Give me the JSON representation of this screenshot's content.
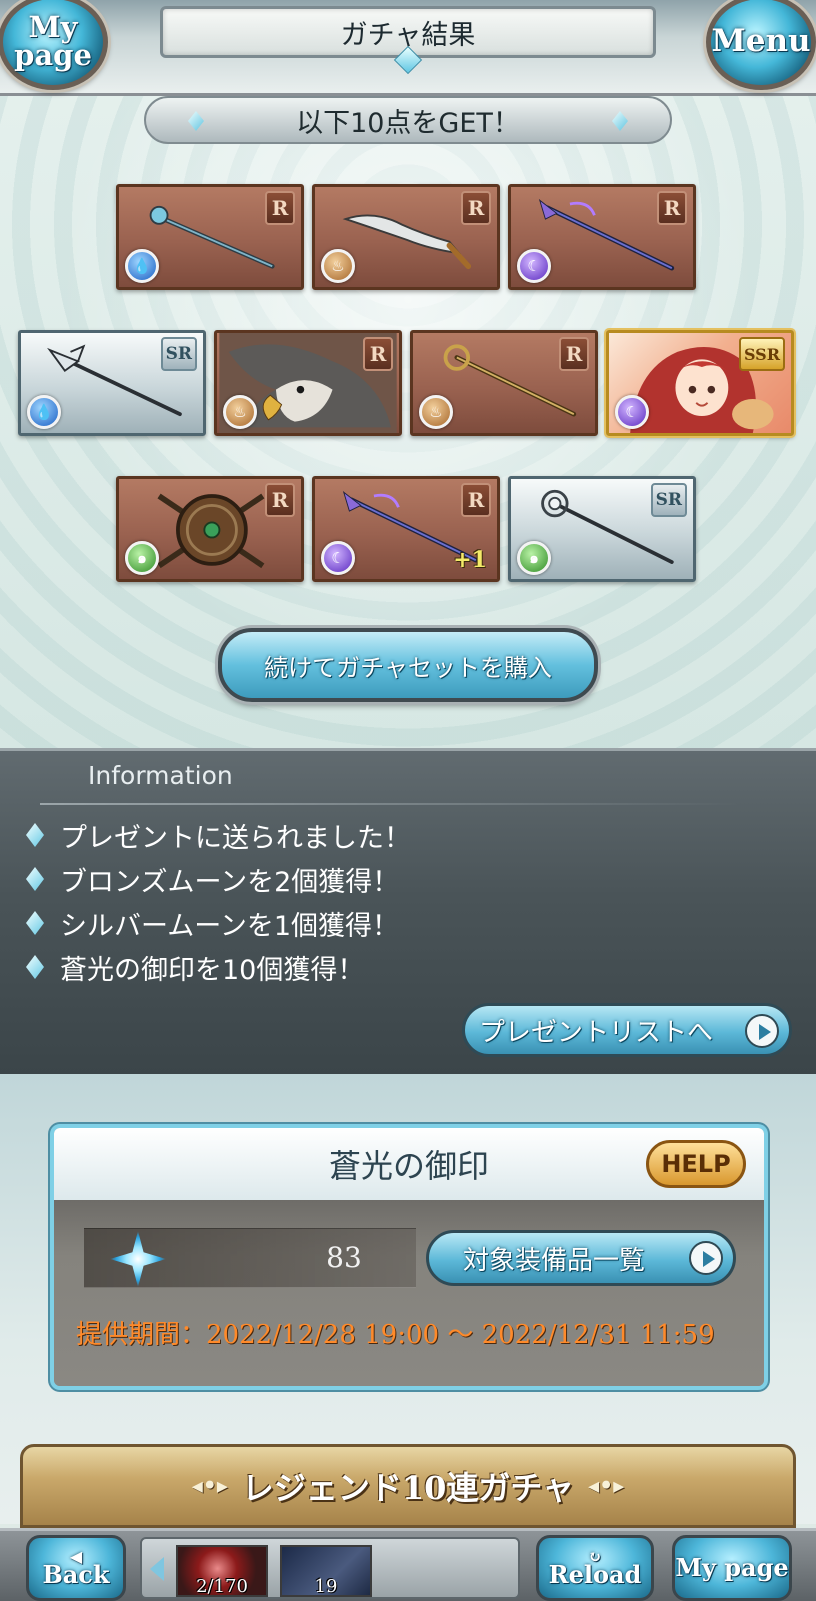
{
  "header": {
    "title": "ガチャ結果",
    "mypage_label": "My page",
    "menu_label": "Menu"
  },
  "get_banner": "以下10点をGET！",
  "items": [
    {
      "rarity": "R",
      "element": "water",
      "art": "staff"
    },
    {
      "rarity": "R",
      "element": "earth",
      "art": "sword"
    },
    {
      "rarity": "R",
      "element": "dark",
      "art": "staff"
    },
    {
      "rarity": "SR",
      "element": "water",
      "art": "spear"
    },
    {
      "rarity": "R",
      "element": "earth",
      "art": "griffin-summon"
    },
    {
      "rarity": "R",
      "element": "earth",
      "art": "staff"
    },
    {
      "rarity": "SSR",
      "element": "dark",
      "art": "character"
    },
    {
      "rarity": "R",
      "element": "wind",
      "art": "shield"
    },
    {
      "rarity": "R",
      "element": "dark",
      "art": "staff",
      "plus": "+1"
    },
    {
      "rarity": "SR",
      "element": "wind",
      "art": "staff"
    }
  ],
  "continue_button": "続けてガチャセットを購入",
  "information": {
    "title": "Information",
    "lines": [
      "プレゼントに送られました！",
      "ブロンズムーンを2個獲得！",
      "シルバームーンを1個獲得！",
      "蒼光の御印を10個獲得！"
    ],
    "present_button": "プレゼントリストへ"
  },
  "seal": {
    "title": "蒼光の御印",
    "help_label": "HELP",
    "count": "83",
    "equip_button": "対象装備品一覧",
    "period": "提供期間：2022/12/28 19:00 〜 2022/12/31 11:59"
  },
  "legend_banner": "レジェンド10連ガチャ",
  "footer": {
    "back_label": "Back",
    "reload_label": "Reload",
    "mypage_label": "My page",
    "tray_items": [
      {
        "icon": "moon-ticket-icon",
        "count": "2/170"
      },
      {
        "icon": "scroll-ticket-icon",
        "count": "19"
      }
    ]
  },
  "colors": {
    "accent_blue": "#5cb8d8",
    "period_orange": "#ff8a2a",
    "info_panel": "#4a5458"
  }
}
